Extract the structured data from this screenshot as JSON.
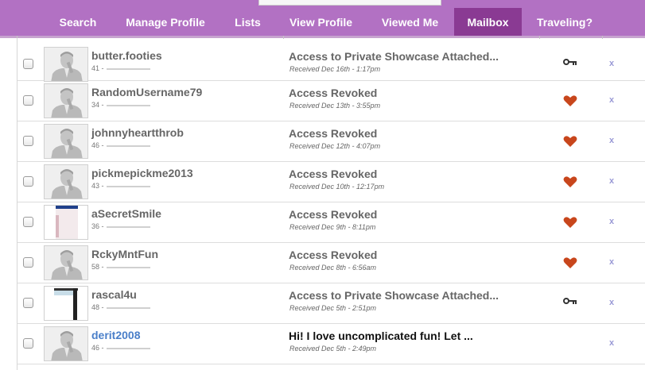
{
  "nav": {
    "items": [
      {
        "label": "Search"
      },
      {
        "label": "Manage Profile"
      },
      {
        "label": "Lists"
      },
      {
        "label": "View Profile"
      },
      {
        "label": "Viewed Me"
      },
      {
        "label": "Mailbox",
        "active": true
      },
      {
        "label": "Traveling?"
      }
    ],
    "color": "#b271c3",
    "active_color": "#8a3a93"
  },
  "messages": [
    {
      "username": "butter.footies",
      "age": "41 -",
      "subject": "Access to Private Showcase Attached...",
      "received": "Received Dec 16th - 1:17pm",
      "type_icon": "key-icon",
      "thumb": "silhouette"
    },
    {
      "username": "RandomUsername79",
      "age": "34 -",
      "subject": "Access Revoked",
      "received": "Received Dec 13th - 3:55pm",
      "type_icon": "heart-icon",
      "thumb": "silhouette"
    },
    {
      "username": "johnnyheartthrob",
      "age": "46 -",
      "subject": "Access Revoked",
      "received": "Received Dec 12th - 4:07pm",
      "type_icon": "heart-icon",
      "thumb": "silhouette"
    },
    {
      "username": "pickmepickme2013",
      "age": "43 -",
      "subject": "Access Revoked",
      "received": "Received Dec 10th - 12:17pm",
      "type_icon": "heart-icon",
      "thumb": "silhouette"
    },
    {
      "username": "aSecretSmile",
      "age": "36 -",
      "subject": "Access Revoked",
      "received": "Received Dec 9th - 8:11pm",
      "type_icon": "heart-icon",
      "thumb": "photo-a"
    },
    {
      "username": "RckyMntFun",
      "age": "58 -",
      "subject": "Access Revoked",
      "received": "Received Dec 8th - 6:56am",
      "type_icon": "heart-icon",
      "thumb": "silhouette"
    },
    {
      "username": "rascal4u",
      "age": "48 -",
      "subject": "Access to Private Showcase Attached...",
      "received": "Received Dec 5th - 2:51pm",
      "type_icon": "key-icon",
      "thumb": "photo-b"
    },
    {
      "username": "derit2008",
      "age": "46 -",
      "subject": "Hi! I love uncomplicated fun! Let ...",
      "received": "Received Dec 5th - 2:49pm",
      "type_icon": "none",
      "thumb": "silhouette",
      "unread": true
    }
  ],
  "delete_glyph": "x",
  "colors": {
    "heart": "#c8461c",
    "key": "#333333",
    "link": "#4a7fc9"
  }
}
